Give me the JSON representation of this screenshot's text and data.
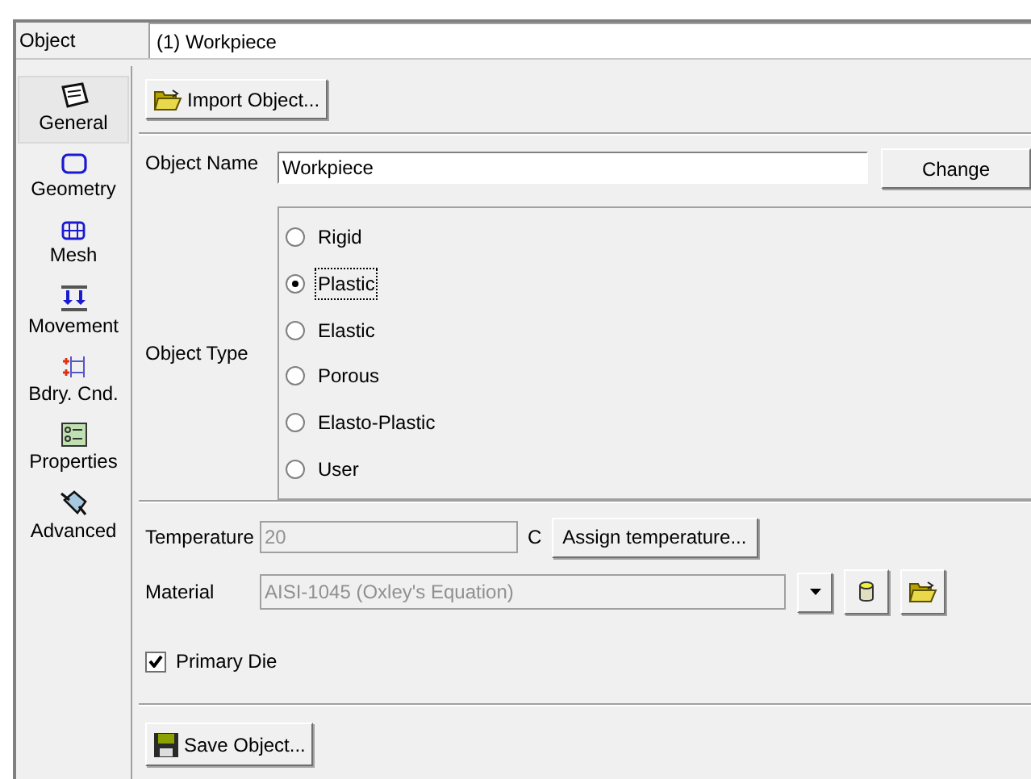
{
  "object": {
    "label": "Object",
    "value": "(1) Workpiece"
  },
  "sidebar": {
    "items": [
      {
        "kind": "general",
        "label": "General",
        "selected": true
      },
      {
        "kind": "geometry",
        "label": "Geometry",
        "selected": false
      },
      {
        "kind": "mesh",
        "label": "Mesh",
        "selected": false
      },
      {
        "kind": "movement",
        "label": "Movement",
        "selected": false
      },
      {
        "kind": "bdry",
        "label": "Bdry. Cnd.",
        "selected": false
      },
      {
        "kind": "properties",
        "label": "Properties",
        "selected": false
      },
      {
        "kind": "advanced",
        "label": "Advanced",
        "selected": false
      }
    ]
  },
  "import_button": "Import Object...",
  "object_name": {
    "label": "Object Name",
    "value": "Workpiece",
    "button": "Change"
  },
  "object_type": {
    "label": "Object Type",
    "options": [
      {
        "label": "Rigid",
        "selected": false
      },
      {
        "label": "Plastic",
        "selected": true
      },
      {
        "label": "Elastic",
        "selected": false
      },
      {
        "label": "Porous",
        "selected": false
      },
      {
        "label": "Elasto-Plastic",
        "selected": false
      },
      {
        "label": "User",
        "selected": false
      }
    ]
  },
  "temperature": {
    "label": "Temperature",
    "value": "20",
    "unit": "C",
    "button": "Assign temperature...",
    "disabled": true
  },
  "material": {
    "label": "Material",
    "value": "AISI-1045 (Oxley's Equation)",
    "disabled": true
  },
  "primary_die": {
    "label": "Primary Die",
    "checked": true
  },
  "save_button": "Save Object..."
}
